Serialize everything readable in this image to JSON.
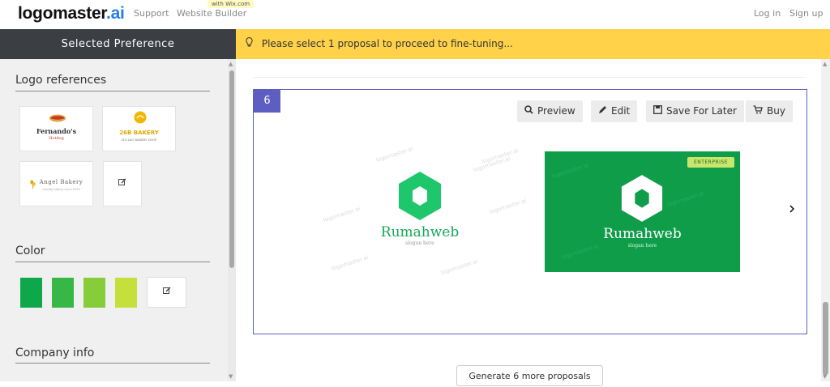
{
  "header": {
    "brand_main": "logomaster",
    "brand_ai": ".ai",
    "nav": [
      "Support",
      "Website Builder"
    ],
    "wix_tag": "with Wix.com",
    "login": "Log in",
    "signup": "Sign up"
  },
  "sidebar": {
    "heading": "Selected Preference",
    "logo_refs_title": "Logo references",
    "references": [
      {
        "name": "Fernando's",
        "sub": "Hotdog"
      },
      {
        "name": "26B BAKERY",
        "sub": "ZIG ZAG BAKERY SHOP"
      },
      {
        "name": "Angel Bakery",
        "sub": "Quality bakery since 1990"
      }
    ],
    "color_title": "Color",
    "colors": [
      "#0ea84a",
      "#37b745",
      "#86ce39",
      "#c5e03b"
    ],
    "company_title": "Company info"
  },
  "notice": {
    "icon": "lightbulb-icon",
    "text": "Please select 1 proposal to proceed to fine-tuning..."
  },
  "proposal": {
    "number": "6",
    "actions": [
      {
        "label": "Preview",
        "icon": "search-icon"
      },
      {
        "label": "Edit",
        "icon": "pencil-icon"
      },
      {
        "label": "Save For Later",
        "icon": "save-icon"
      },
      {
        "label": "Buy",
        "icon": "cart-icon"
      }
    ],
    "logo_name": "Rumahweb",
    "logo_slogan": "slogan here",
    "enterprise_badge": "ENTERPRISE",
    "watermark": "logomaster.ai",
    "colors": {
      "primary": "#0f9d4a",
      "accent": "#5c5fc1",
      "logo_green": "#1ec76b"
    }
  },
  "generate_button": "Generate 6 more proposals"
}
